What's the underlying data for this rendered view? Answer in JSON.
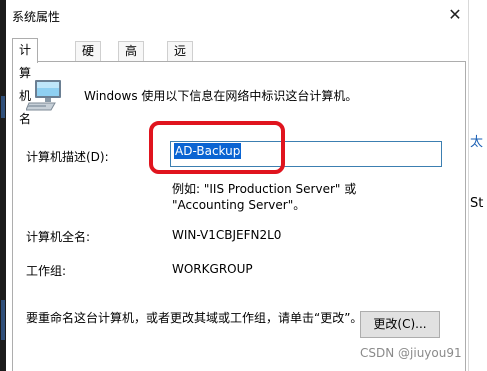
{
  "window": {
    "title": "系统属性",
    "close_glyph": "✕"
  },
  "tabs": [
    {
      "label": "计算机名",
      "active": true
    },
    {
      "label": "硬件",
      "active": false
    },
    {
      "label": "高级",
      "active": false
    },
    {
      "label": "远程",
      "active": false
    }
  ],
  "intro_text": "Windows 使用以下信息在网络中标识这台计算机。",
  "description": {
    "label": "计算机描述(D):",
    "value": "AD-Backup",
    "example": "例如: \"IIS Production Server\" 或 \"Accounting Server\"。"
  },
  "full_name": {
    "label": "计算机全名:",
    "value": "WIN-V1CBJEFN2L0"
  },
  "workgroup": {
    "label": "工作组:",
    "value": "WORKGROUP"
  },
  "rename_note": "要重命名这台计算机，或者更改其域或工作组，请单击“更改”。",
  "change_button_label": "更改(C)...",
  "background_fragments": {
    "a": "太",
    "b": "St"
  },
  "watermark": "CSDN @jiuyou91",
  "colors": {
    "selection": "#0a64d2",
    "highlight_box": "#e0141e",
    "input_border": "#3c7fb1"
  }
}
